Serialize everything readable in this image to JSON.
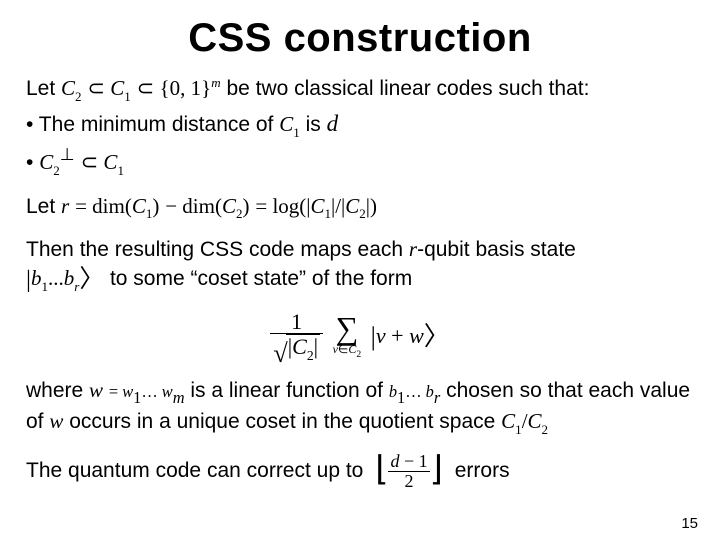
{
  "title": "CSS construction",
  "line1": {
    "pre": "Let ",
    "c2": "C",
    "c2sub": "2",
    "sub1": " ",
    "c1": "C",
    "c1sub": "1",
    "sub2": " ",
    "set_open": "{",
    "zero": "0",
    "comma": ", ",
    "one": "1",
    "set_close": "}",
    "m": "m",
    "post": " be two classical linear codes such that:"
  },
  "bullet1": {
    "pre": "• The minimum distance of ",
    "c1": "C",
    "c1sub": "1",
    "mid": " is ",
    "d": "d"
  },
  "bullet2": {
    "pre": "• ",
    "c2": "C",
    "c2sub": "2",
    "perp": "⊥",
    "mid": " ",
    "c1": "C",
    "c1sub": "1"
  },
  "line_r": {
    "pre": "Let  ",
    "r": "r",
    "eq": " = ",
    "dim1a": "dim(",
    "c1": "C",
    "c1sub": "1",
    "dim1b": ")",
    "minus": " − ",
    "dim2a": "dim(",
    "c2": "C",
    "c2sub": "2",
    "dim2b": ")",
    "eq2": " = ",
    "log": " log(|",
    "lc1": "C",
    "lc1sub": "1",
    "mid": "|/|",
    "lc2": "C",
    "lc2sub": "2",
    "end": "|)"
  },
  "para_then": {
    "pre": "Then the resulting CSS code maps each ",
    "r": "r",
    "mid": "-qubit basis state ",
    "ket_l": "|",
    "b": "b",
    "b1sub": "1",
    "dots": "...",
    "br": "b",
    "brsub": "r",
    "ket_r": "〉",
    "post": " to some “coset state” of the form"
  },
  "formula": {
    "frac_num": "1",
    "sqrt_body_open": "|",
    "sqrt_c2": "C",
    "sqrt_c2sub": "2",
    "sqrt_body_close": "|",
    "sum_sub_pre": "v",
    "sum_sub_in": "∈",
    "sum_sub_c2": "C",
    "sum_sub_c2sub": "2",
    "sigma": "∑",
    "ket_l": "|",
    "v": "v",
    "plus": " + ",
    "w": "w",
    "ket_r": "〉"
  },
  "para_where": {
    "pre": "where ",
    "w": "w",
    "eq": " = ",
    "w1": "w",
    "w1sub": "1",
    "dots": "… ",
    "wm": "w",
    "wmsub": "m",
    "mid": " is a linear function of ",
    "b1": "b",
    "b1sub": "1",
    "dots2": "… ",
    "br": "b",
    "brsub": "r",
    "post1": " chosen so that each value of ",
    "w2": "w",
    "post2": " occurs in a unique coset in the quotient space ",
    "c1": "C",
    "c1sub": "1",
    "slash": "/",
    "c2": "C",
    "c2sub": "2"
  },
  "lastline": {
    "pre": "The quantum code can correct up to ",
    "floor_num_a": "d",
    "floor_num_b": " − 1",
    "floor_den": "2",
    "post": " errors"
  },
  "pagenum": "15"
}
